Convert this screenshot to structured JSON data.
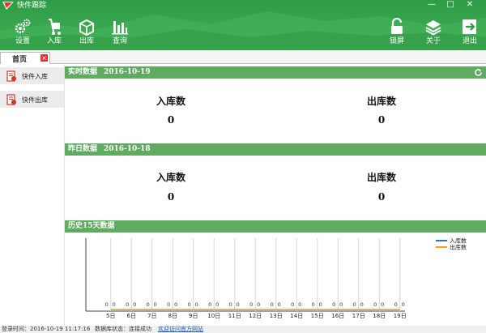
{
  "app": {
    "title": "快件跟踪"
  },
  "window": {
    "minimize": "—",
    "maximize": "□",
    "close": "✕"
  },
  "toolbar": {
    "left": [
      {
        "key": "settings",
        "label": "设置",
        "icon": "gears-icon"
      },
      {
        "key": "inbound",
        "label": "入库",
        "icon": "hand-truck-icon"
      },
      {
        "key": "outbound",
        "label": "出库",
        "icon": "box-out-icon"
      },
      {
        "key": "query",
        "label": "查询",
        "icon": "bar-chart-icon"
      }
    ],
    "right": [
      {
        "key": "lock",
        "label": "锁屏",
        "icon": "padlock-icon"
      },
      {
        "key": "about",
        "label": "关于",
        "icon": "layers-icon"
      },
      {
        "key": "exit",
        "label": "退出",
        "icon": "exit-icon"
      }
    ]
  },
  "tabs": {
    "home": "首页",
    "close": "×"
  },
  "sidebar": {
    "items": [
      {
        "label": "快件入库",
        "icon": "inbound-doc-icon"
      },
      {
        "label": "快件出库",
        "icon": "outbound-doc-icon"
      }
    ]
  },
  "realtime": {
    "title": "实时数据",
    "date": "2016-10-19",
    "in_label": "入库数",
    "in_value": "0",
    "out_label": "出库数",
    "out_value": "0"
  },
  "yesterday": {
    "title": "昨日数据",
    "date": "2016-10-18",
    "in_label": "入库数",
    "in_value": "0",
    "out_label": "出库数",
    "out_value": "0"
  },
  "history": {
    "title": "历史15天数据"
  },
  "chart_data": {
    "type": "line",
    "categories": [
      "5日",
      "6日",
      "7日",
      "8日",
      "9日",
      "10日",
      "11日",
      "12日",
      "13日",
      "14日",
      "15日",
      "16日",
      "17日",
      "18日",
      "19日"
    ],
    "series": [
      {
        "name": "入库数",
        "values": [
          0,
          0,
          0,
          0,
          0,
          0,
          0,
          0,
          0,
          0,
          0,
          0,
          0,
          0,
          0
        ],
        "color": "#2f6fd6"
      },
      {
        "name": "出库数",
        "values": [
          0,
          0,
          0,
          0,
          0,
          0,
          0,
          0,
          0,
          0,
          0,
          0,
          0,
          0,
          0
        ],
        "color": "#f0a020"
      }
    ],
    "legend": "top-right",
    "grid": true
  },
  "status": {
    "login_label": "登录时间：2016-10-19 11:17:16",
    "db_label": "数据库状态：连接成功",
    "link": "欢迎访问官方网站"
  },
  "colors": {
    "brand": "#38a44c",
    "panel": "#5fab5f"
  }
}
